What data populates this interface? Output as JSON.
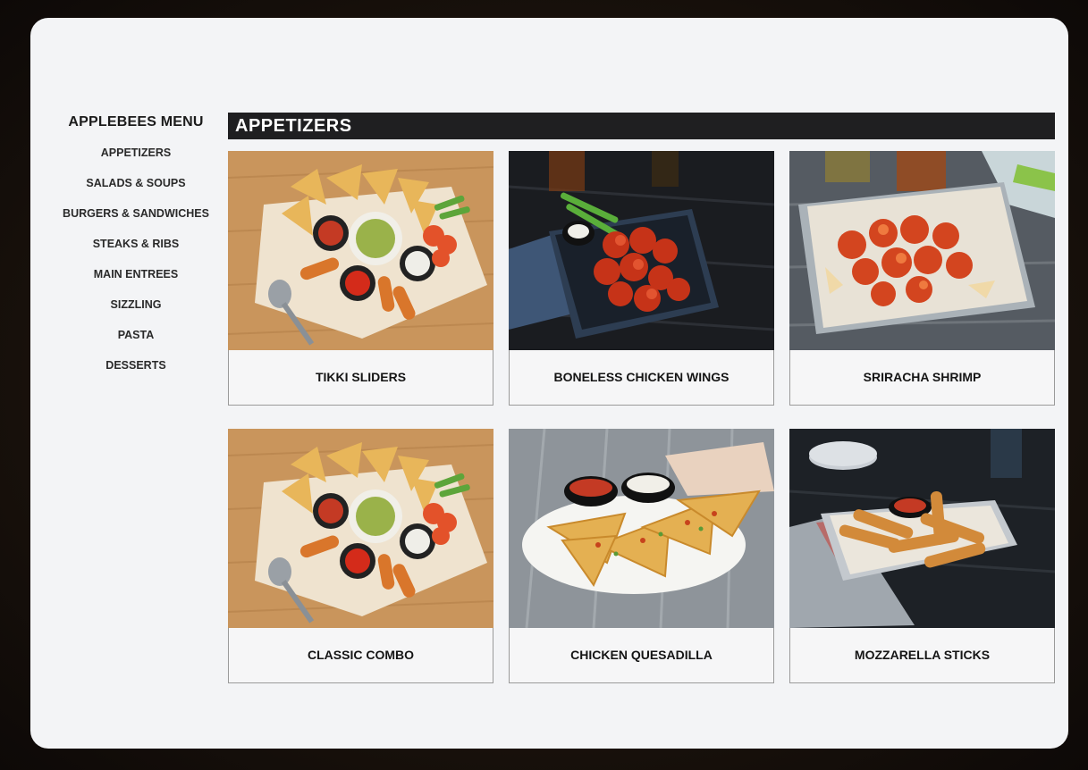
{
  "sidebar": {
    "title": "APPLEBEES MENU",
    "items": [
      {
        "label": "APPETIZERS"
      },
      {
        "label": "SALADS & SOUPS"
      },
      {
        "label": "BURGERS & SANDWICHES"
      },
      {
        "label": "STEAKS & RIBS"
      },
      {
        "label": "MAIN ENTREES"
      },
      {
        "label": "SIZZLING"
      },
      {
        "label": "PASTA"
      },
      {
        "label": "DESSERTS"
      }
    ]
  },
  "section": {
    "title": "APPETIZERS"
  },
  "cards": [
    {
      "label": "TIKKI SLIDERS"
    },
    {
      "label": "BONELESS CHICKEN WINGS"
    },
    {
      "label": "SRIRACHA SHRIMP"
    },
    {
      "label": "CLASSIC COMBO"
    },
    {
      "label": "CHICKEN QUESADILLA"
    },
    {
      "label": "MOZZARELLA STICKS"
    }
  ]
}
